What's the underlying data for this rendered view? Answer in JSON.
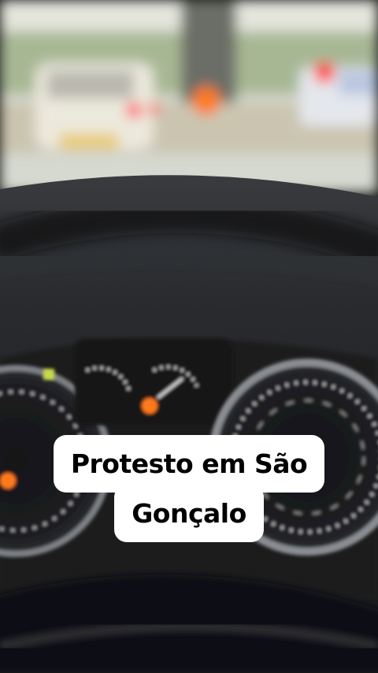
{
  "video": {
    "caption_lines": [
      "Protesto em São",
      "Gonçalo"
    ]
  },
  "colors": {
    "sky": "#dfe3d9",
    "trees": "#9cb08a",
    "road": "#c9c3ad",
    "dashboard": "#1e1f22",
    "brake_light": "#ff7a1a",
    "caption_bg": "#ffffff",
    "caption_text": "#000000"
  }
}
